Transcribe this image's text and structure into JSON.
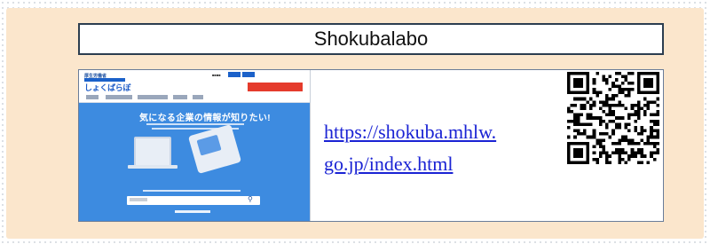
{
  "card": {
    "title": "Shokubalabo",
    "url_line1": "https://shokuba.mhlw.",
    "url_line2": "go.jp/index.html"
  },
  "thumbnail": {
    "ministry": "厚生労働省",
    "logo": "しょくばらぼ",
    "hero_title": "気になる企業の情報が知りたい!"
  },
  "colors": {
    "panel_bg": "#fbe6cc",
    "link": "#1a23d4",
    "site_blue": "#3d8be0",
    "site_red": "#e53b2c"
  },
  "icons": {
    "qr": "qr-code-icon",
    "search": "search-icon"
  }
}
